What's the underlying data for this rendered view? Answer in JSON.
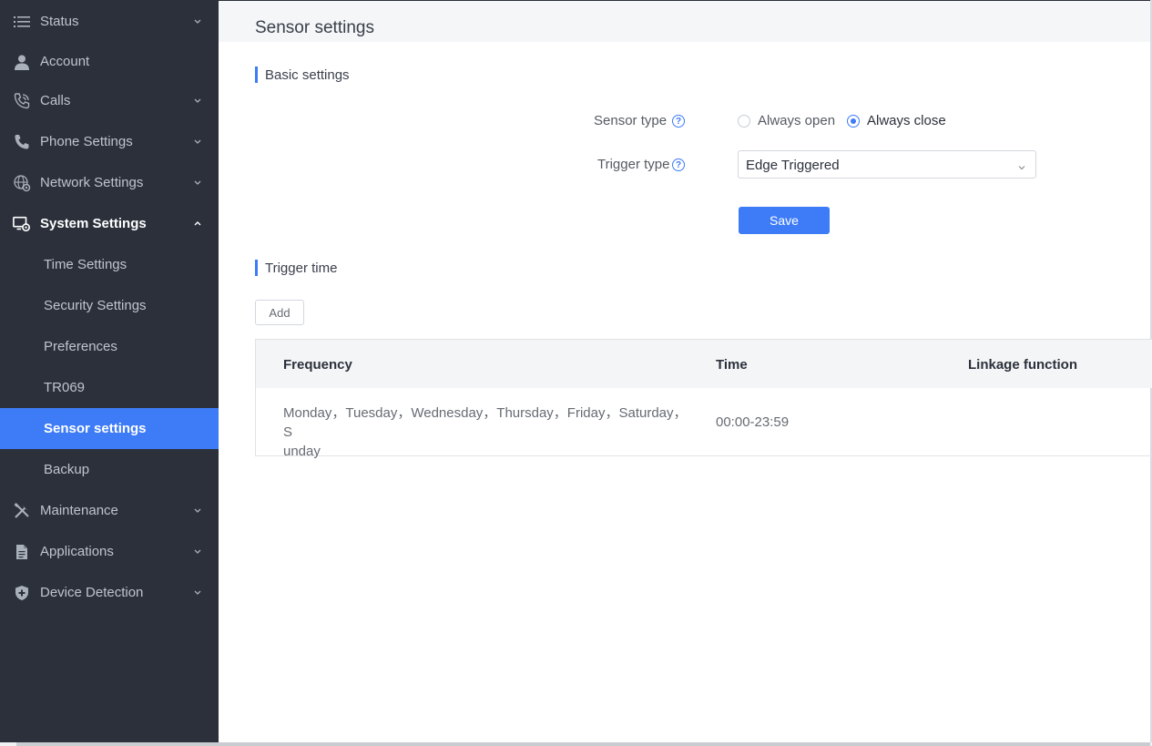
{
  "sidebar": {
    "items": [
      {
        "label": "Status",
        "icon": "list-icon",
        "has_chevron": true
      },
      {
        "label": "Account",
        "icon": "user-icon",
        "has_chevron": false
      },
      {
        "label": "Calls",
        "icon": "phone-call-icon",
        "has_chevron": true
      },
      {
        "label": "Phone Settings",
        "icon": "phone-icon",
        "has_chevron": true
      },
      {
        "label": "Network Settings",
        "icon": "globe-gear-icon",
        "has_chevron": true
      },
      {
        "label": "System Settings",
        "icon": "monitor-gear-icon",
        "has_chevron": true,
        "expanded": true
      },
      {
        "label": "Maintenance",
        "icon": "tools-icon",
        "has_chevron": true
      },
      {
        "label": "Applications",
        "icon": "document-icon",
        "has_chevron": true
      },
      {
        "label": "Device Detection",
        "icon": "shield-icon",
        "has_chevron": true
      }
    ],
    "sub_items": [
      {
        "label": "Time Settings"
      },
      {
        "label": "Security Settings"
      },
      {
        "label": "Preferences"
      },
      {
        "label": "TR069"
      },
      {
        "label": "Sensor settings",
        "active": true
      },
      {
        "label": "Backup"
      }
    ]
  },
  "page": {
    "title": "Sensor settings"
  },
  "basic": {
    "heading": "Basic settings",
    "sensor_type_label": "Sensor type",
    "sensor_options": [
      "Always open",
      "Always close"
    ],
    "sensor_selected": "Always close",
    "trigger_type_label": "Trigger type",
    "trigger_type_value": "Edge Triggered",
    "save_label": "Save"
  },
  "trigger": {
    "heading": "Trigger time",
    "add_label": "Add",
    "columns": [
      "Frequency",
      "Time",
      "Linkage function"
    ],
    "rows": [
      {
        "frequency": "Monday，Tuesday，Wednesday，Thursday，Friday，Saturday，Sunday",
        "frequency_line1": "Monday，Tuesday，Wednesday，Thursday，Friday，Saturday，S",
        "frequency_line2": "unday",
        "time": "00:00-23:59",
        "linkage": ""
      }
    ]
  },
  "colors": {
    "accent": "#3d7bf7",
    "sidebar_bg": "#2b303b"
  }
}
